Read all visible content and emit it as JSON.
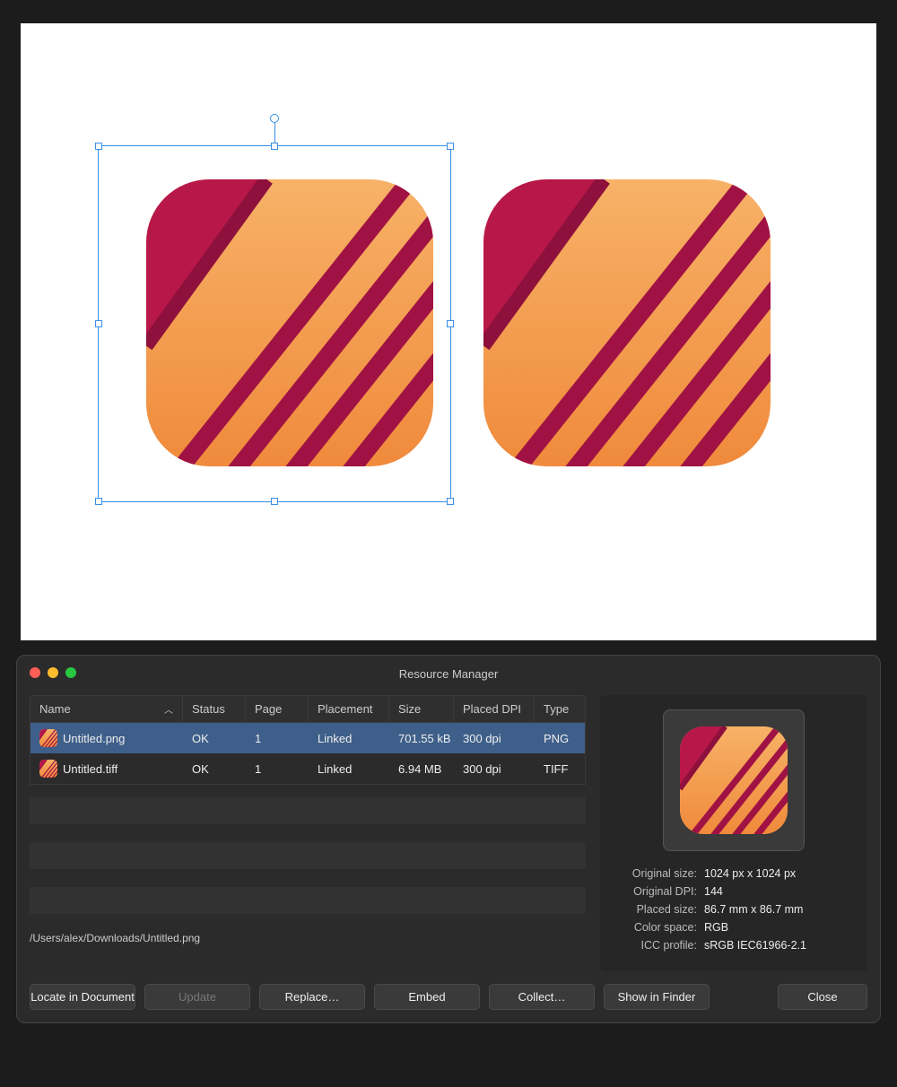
{
  "dialog": {
    "title": "Resource Manager",
    "columns": {
      "name": "Name",
      "status": "Status",
      "page": "Page",
      "placement": "Placement",
      "size": "Size",
      "placed_dpi": "Placed DPI",
      "type": "Type"
    },
    "rows": [
      {
        "name": "Untitled.png",
        "status": "OK",
        "page": "1",
        "placement": "Linked",
        "size": "701.55 kB",
        "dpi": "300 dpi",
        "type": "PNG",
        "selected": true
      },
      {
        "name": "Untitled.tiff",
        "status": "OK",
        "page": "1",
        "placement": "Linked",
        "size": "6.94 MB",
        "dpi": "300 dpi",
        "type": "TIFF",
        "selected": false
      }
    ],
    "file_path": "/Users/alex/Downloads/Untitled.png",
    "details": {
      "original_size_label": "Original size:",
      "original_size": "1024 px x 1024 px",
      "original_dpi_label": "Original DPI:",
      "original_dpi": "144",
      "placed_size_label": "Placed size:",
      "placed_size": "86.7 mm x 86.7 mm",
      "color_space_label": "Color space:",
      "color_space": "RGB",
      "icc_label": "ICC profile:",
      "icc": "sRGB IEC61966-2.1"
    },
    "buttons": {
      "locate": "Locate in Document",
      "update": "Update",
      "replace": "Replace…",
      "embed": "Embed",
      "collect": "Collect…",
      "show": "Show in Finder",
      "close": "Close"
    }
  }
}
